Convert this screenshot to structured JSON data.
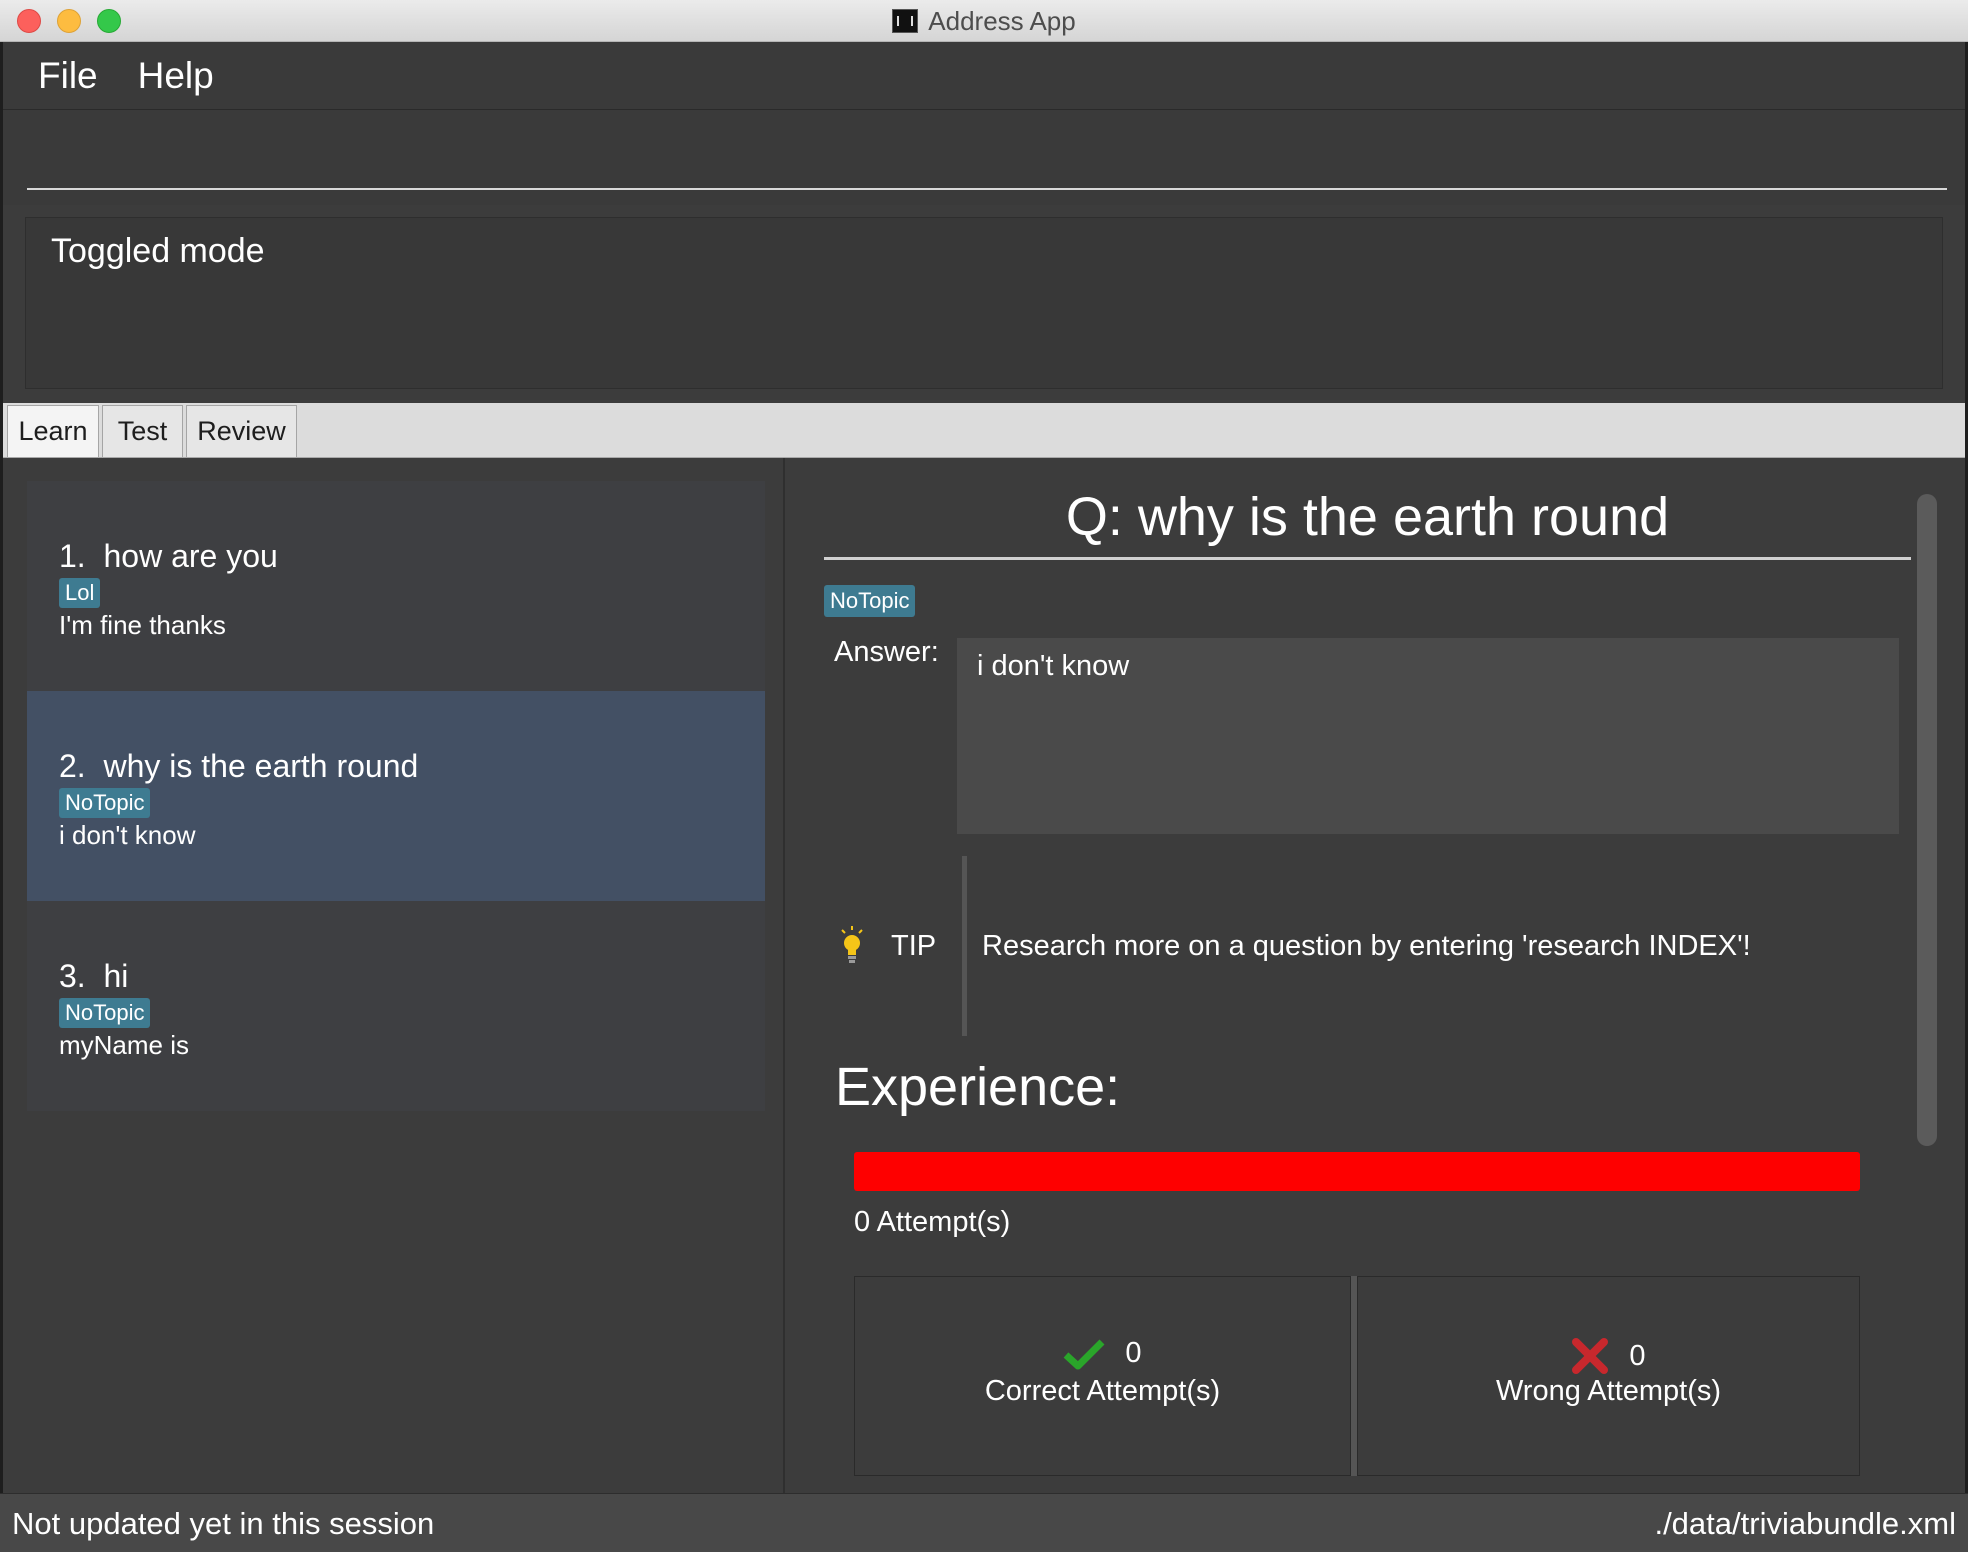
{
  "window": {
    "title": "Address App",
    "app_icon": "address-app-icon"
  },
  "menu": [
    "File",
    "Help"
  ],
  "command": {
    "value": ""
  },
  "result": {
    "text": "Toggled mode"
  },
  "tabs": [
    {
      "label": "Learn",
      "active": true
    },
    {
      "label": "Test",
      "active": false
    },
    {
      "label": "Review",
      "active": false
    }
  ],
  "cards": [
    {
      "index": "1.",
      "question": "how are you",
      "tag": "Lol",
      "answer": "I'm fine thanks",
      "selected": false
    },
    {
      "index": "2.",
      "question": "why is the earth round",
      "tag": "NoTopic",
      "answer": "i don't know",
      "selected": true
    },
    {
      "index": "3.",
      "question": "hi",
      "tag": "NoTopic",
      "answer": "myName is",
      "selected": false
    }
  ],
  "detail": {
    "question": "Q: why is the earth round",
    "tag": "NoTopic",
    "answer_label": "Answer:",
    "answer": "i don't know",
    "tip_label": "TIP",
    "tip_text": "Research more on a question by entering 'research INDEX'!",
    "experience_label": "Experience:",
    "progress_fraction": 0.0,
    "progress_color": "#fe0000",
    "attempts_text": "0 Attempt(s)",
    "correct": {
      "count": "0",
      "label": "Correct Attempt(s)",
      "icon": "checkmark-icon",
      "color": "#2aa52a"
    },
    "wrong": {
      "count": "0",
      "label": "Wrong Attempt(s)",
      "icon": "cross-icon",
      "color": "#c8282d"
    }
  },
  "status": {
    "left": "Not updated yet in this session",
    "right": "./data/triviabundle.xml"
  },
  "colors": {
    "background": "#3c3c3c",
    "selected_card": "#435064",
    "tag": "#3e7b91"
  }
}
